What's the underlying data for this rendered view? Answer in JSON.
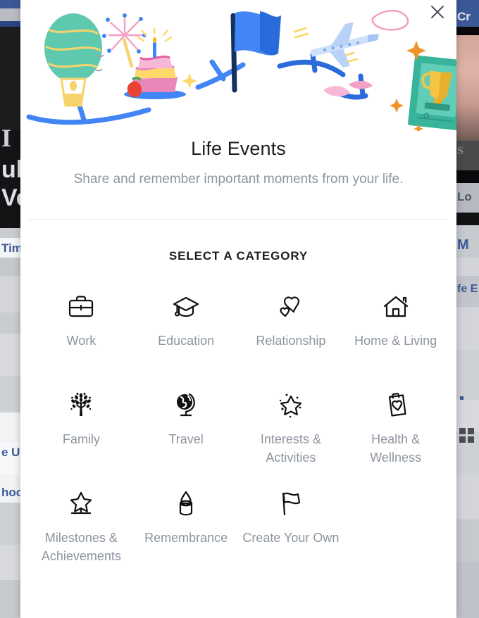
{
  "modal": {
    "close_icon": "close-icon",
    "title": "Life Events",
    "subtitle": "Share and remember important moments from your life.",
    "section_heading": "SELECT A CATEGORY",
    "hero_illustration": {
      "name": "life-events-hero-illustration",
      "elements": [
        "hot-air-balloon",
        "sparkler",
        "birthday-cake",
        "blue-flag",
        "airplane",
        "trophy-photo-frame",
        "confetti-sparkles"
      ],
      "colors": {
        "balloon": "#5fc9b0",
        "balloon_stripe": "#f7d36b",
        "cake_pink": "#f0a3c8",
        "cake_yellow": "#ffd86b",
        "flag_blue": "#4a86e8",
        "flag_dark": "#1b3a6b",
        "swoosh_blue": "#3b82f6",
        "plane_blue": "#b9d2f7",
        "trophy_gold": "#f5c542",
        "frame_teal": "#37b49a",
        "pink_accent": "#f2a0c4",
        "orange_accent": "#f0932b"
      }
    },
    "categories": [
      {
        "label": "Work",
        "icon": "briefcase-icon"
      },
      {
        "label": "Education",
        "icon": "graduation-cap-icon"
      },
      {
        "label": "Relationship",
        "icon": "two-hearts-icon"
      },
      {
        "label": "Home & Living",
        "icon": "house-icon"
      },
      {
        "label": "Family",
        "icon": "family-tree-icon"
      },
      {
        "label": "Travel",
        "icon": "globe-icon"
      },
      {
        "label": "Interests & Activities",
        "icon": "star-sparkle-icon"
      },
      {
        "label": "Health & Wellness",
        "icon": "clipboard-heart-icon"
      },
      {
        "label": "Milestones & Achievements",
        "icon": "star-pedestal-icon"
      },
      {
        "label": "Remembrance",
        "icon": "candle-icon"
      },
      {
        "label": "Create Your Own",
        "icon": "waving-flag-icon"
      }
    ]
  },
  "background": {
    "left_column": {
      "fragments": [
        "I",
        "ul",
        "Ve",
        "Tim",
        "e Un",
        "hoo"
      ]
    },
    "right_column": {
      "fragments": [
        "Cr",
        "S",
        "Lo",
        "M",
        "fe E"
      ]
    }
  },
  "colors": {
    "brand_blue": "#3b5998",
    "modal_bg": "#ffffff",
    "text_primary": "#1c1e21",
    "text_secondary": "#8d949e",
    "divider": "#e4e6eb"
  }
}
